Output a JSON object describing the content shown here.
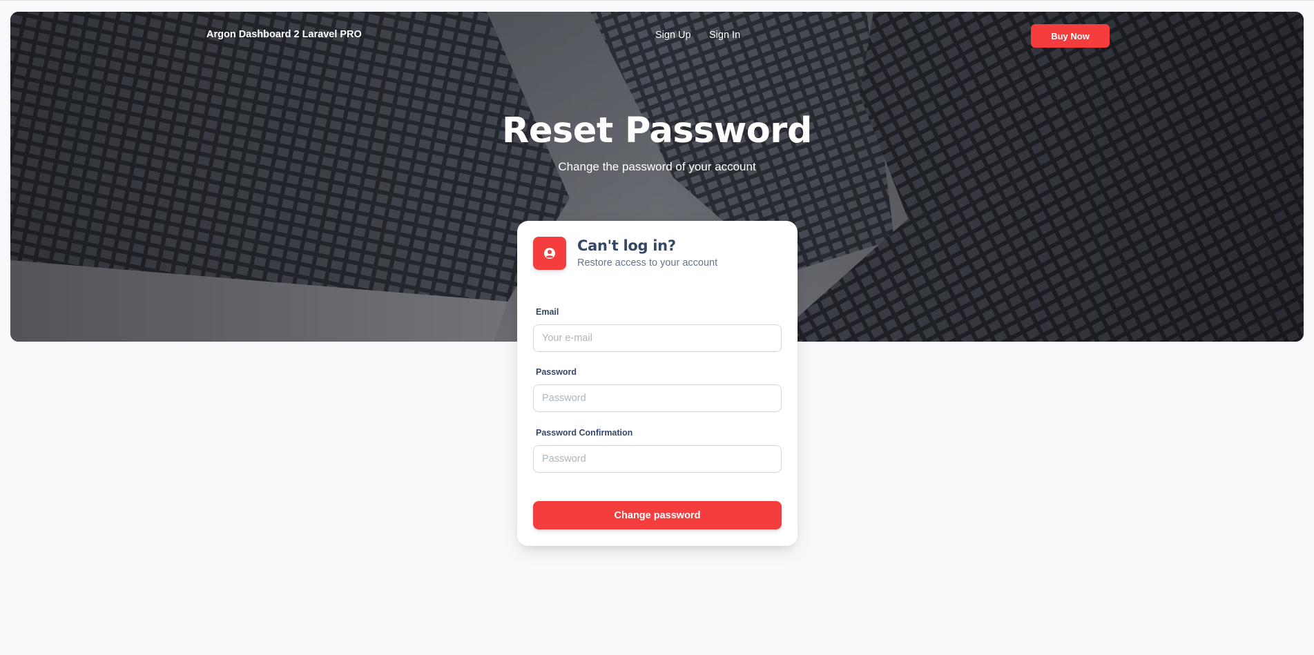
{
  "navbar": {
    "brand": "Argon Dashboard 2 Laravel PRO",
    "links": [
      "Sign Up",
      "Sign In"
    ],
    "cta_label": "Buy Now"
  },
  "hero": {
    "title": "Reset Password",
    "subtitle": "Change the password of your account"
  },
  "card": {
    "icon": "user-circle-icon",
    "title": "Can't log in?",
    "subtitle": "Restore access to your account",
    "fields": [
      {
        "label": "Email",
        "placeholder": "Your e-mail",
        "value": ""
      },
      {
        "label": "Password",
        "placeholder": "Password",
        "value": ""
      },
      {
        "label": "Password Confirmation",
        "placeholder": "Password",
        "value": ""
      }
    ],
    "submit_label": "Change password"
  },
  "colors": {
    "accent": "#f53d3d",
    "heading": "#344767",
    "muted": "#67748e",
    "page_bg": "#f8f9fa"
  }
}
